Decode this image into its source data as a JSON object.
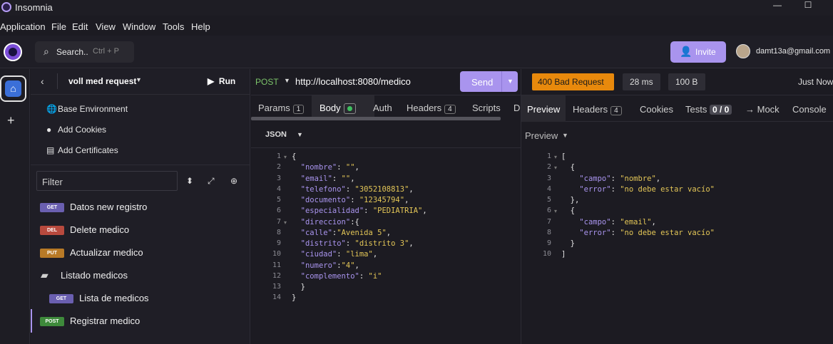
{
  "window": {
    "title": "Insomnia",
    "minimize": "—",
    "maximize": "☐"
  },
  "menu": [
    "Application",
    "File",
    "Edit",
    "View",
    "Window",
    "Tools",
    "Help"
  ],
  "topbar": {
    "search_label": "Search..",
    "search_shortcut": "Ctrl + P",
    "invite_label": "Invite",
    "user_email": "damt13a@gmail.com"
  },
  "collection": {
    "name": "voll med request",
    "run_label": "Run",
    "environment": "Base Environment",
    "add_cookies": "Add Cookies",
    "add_certificates": "Add Certificates",
    "filter_placeholder": "Filter"
  },
  "requests": [
    {
      "method": "GET",
      "label": "Datos new registro"
    },
    {
      "method": "DEL",
      "label": "Delete medico"
    },
    {
      "method": "PUT",
      "label": "Actualizar medico"
    },
    {
      "folder": true,
      "label": "Listado medicos"
    },
    {
      "method": "GET",
      "label": "Lista de medicos",
      "indent": true
    },
    {
      "method": "POST",
      "label": "Registrar medico",
      "active": true
    }
  ],
  "request": {
    "method": "POST",
    "url": "http://localhost:8080/medico",
    "send_label": "Send",
    "tabs": {
      "params": "Params",
      "params_count": "1",
      "body": "Body",
      "auth": "Auth",
      "headers": "Headers",
      "headers_count": "4",
      "scripts": "Scripts",
      "docs": "D"
    },
    "body_mode": "JSON",
    "body_lines": [
      "{",
      "  \"nombre\": \"\",",
      "  \"email\": \"\",",
      "  \"telefono\": \"3052108813\",",
      "  \"documento\": \"12345794\",",
      "  \"especialidad\": \"PEDIATRIA\",",
      "  \"direccion\":{",
      "  \"calle\":\"Avenida 5\",",
      "  \"distrito\": \"distrito 3\",",
      "  \"ciudad\": \"lima\",",
      "  \"numero\":\"4\",",
      "  \"complemento\": \"i\"",
      "  }",
      "}"
    ]
  },
  "response": {
    "status": "400 Bad Request",
    "time": "28 ms",
    "size": "100 B",
    "timestamp": "Just Now",
    "tabs": {
      "preview": "Preview",
      "headers": "Headers",
      "headers_count": "4",
      "cookies": "Cookies",
      "tests": "Tests",
      "tests_count": "0 / 0",
      "mock": "→ Mock",
      "console": "Console"
    },
    "preview_mode": "Preview",
    "body_lines": [
      "[",
      "  {",
      "    \"campo\": \"nombre\",",
      "    \"error\": \"no debe estar vacío\"",
      "  },",
      "  {",
      "    \"campo\": \"email\",",
      "    \"error\": \"no debe estar vacío\"",
      "  }",
      "]"
    ]
  },
  "colors": {
    "accent": "#a994ee",
    "status_error": "#e8890c",
    "json_key": "#a994ee",
    "json_string": "#e3c657"
  }
}
